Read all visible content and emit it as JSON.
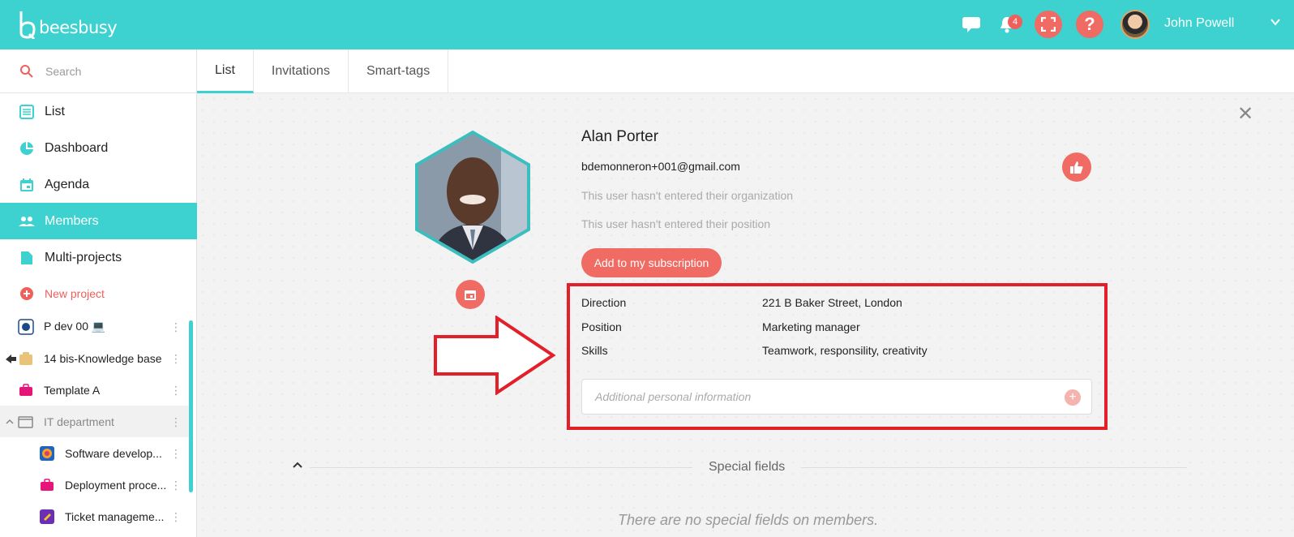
{
  "app": {
    "logo_text": "beesbusy"
  },
  "header": {
    "notification_count": "4",
    "user_name": "John Powell"
  },
  "sidebar": {
    "search_placeholder": "Search",
    "nav": [
      {
        "label": "List",
        "icon": "list-icon"
      },
      {
        "label": "Dashboard",
        "icon": "pie-chart-icon"
      },
      {
        "label": "Agenda",
        "icon": "calendar-icon"
      },
      {
        "label": "Members",
        "icon": "members-icon",
        "active": true
      },
      {
        "label": "Multi-projects",
        "icon": "document-icon"
      }
    ],
    "new_project_label": "New project",
    "projects": [
      {
        "label": "P dev 00 💻",
        "icon": "rebel-icon"
      },
      {
        "label": "14 bis-Knowledge base",
        "icon": "folder-shared-icon"
      },
      {
        "label": "Template A",
        "icon": "briefcase-icon"
      },
      {
        "label": "IT department",
        "icon": "folder-group-icon"
      },
      {
        "label": "Software develop...",
        "icon": "software-icon"
      },
      {
        "label": "Deployment proce...",
        "icon": "briefcase-icon"
      },
      {
        "label": "Ticket manageme...",
        "icon": "ticket-icon"
      }
    ]
  },
  "tabs": [
    {
      "label": "List",
      "active": true
    },
    {
      "label": "Invitations"
    },
    {
      "label": "Smart-tags"
    }
  ],
  "member": {
    "name": "Alan Porter",
    "email": "bdemonneron+001@gmail.com",
    "organization_hint": "This user hasn't entered their organization",
    "position_hint": "This user hasn't entered their position",
    "add_button": "Add to my subscription",
    "details": [
      {
        "label": "Direction",
        "value": "221 B Baker Street, London"
      },
      {
        "label": "Position",
        "value": "Marketing manager"
      },
      {
        "label": "Skills",
        "value": "Teamwork, responsility, creativity"
      }
    ],
    "additional_placeholder": "Additional personal information"
  },
  "special_fields": {
    "title": "Special fields",
    "empty_text": "There are no special fields on members."
  },
  "colors": {
    "brand": "#3dd2cf",
    "accent": "#ef6b63",
    "highlight": "#e3202a"
  }
}
